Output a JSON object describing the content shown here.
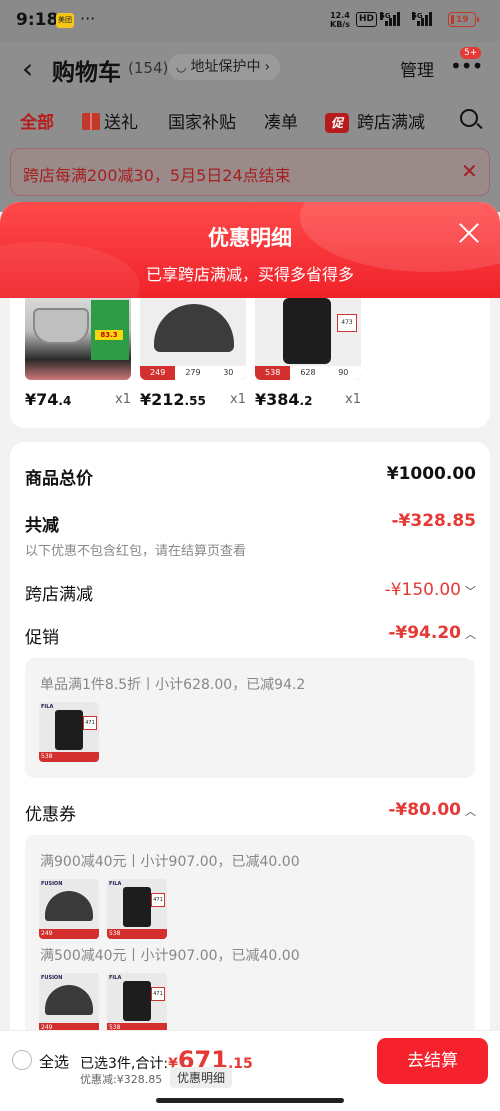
{
  "status_bar": {
    "time": "9:18",
    "app_badge": "美团",
    "net_speed": "12.4",
    "net_unit": "KB/s",
    "hd": "HD",
    "sig1": "5G",
    "sig2": "5G",
    "battery": "19",
    "battery_color": "#c0392b"
  },
  "header": {
    "title": "购物车",
    "count": "(154)",
    "address_label": "地址保护中",
    "manage": "管理",
    "badge": "5+"
  },
  "tabs": [
    {
      "label": "全部",
      "active": true
    },
    {
      "label": "送礼",
      "icon": "gift-icon"
    },
    {
      "label": "国家补贴"
    },
    {
      "label": "凑单"
    },
    {
      "label": "跨店满减",
      "icon": "promo-icon",
      "icon_text": "促"
    }
  ],
  "banner": {
    "text": "跨店每满200减30，5月5日24点结束"
  },
  "sheet": {
    "title": "优惠明细",
    "subtitle": "已享跨店满减，买得多省得多",
    "accent": "#f5222d"
  },
  "products": [
    {
      "price_int": "¥74",
      "price_dec": ".4",
      "qty": "x1",
      "kind": "pot-icon"
    },
    {
      "price_int": "¥212",
      "price_dec": ".55",
      "qty": "x1",
      "kind": "cap-icon",
      "bar": [
        "249",
        "279",
        "30"
      ]
    },
    {
      "price_int": "¥384",
      "price_dec": ".2",
      "qty": "x1",
      "kind": "backpack-icon",
      "tag": "473",
      "bar": [
        "538",
        "628",
        "90"
      ]
    }
  ],
  "pot_tag": "83.3",
  "summary": {
    "total_label": "商品总价",
    "total_value": "¥1000.00",
    "reduce_label": "共减",
    "reduce_value": "-¥328.85",
    "note": "以下优惠不包含红包，请在结算页查看",
    "cross_store_label": "跨店满减",
    "cross_store_value": "-¥150.00",
    "promo_label": "促销",
    "promo_value": "-¥94.20",
    "promo_detail": "单品满1件8.5折丨小计628.00，已减94.2",
    "coupon_label": "优惠券",
    "coupon_value": "-¥80.00",
    "coupon1_detail": "满900减40元丨小计907.00，已减40.00",
    "coupon2_detail": "满500减40元丨小计907.00，已减40.00"
  },
  "thumbs": {
    "brand_fila": "FILA",
    "tag_471": "471",
    "bar_538": "538",
    "bar_249": "249",
    "brand_cap": "FUSION"
  },
  "bottom": {
    "select_all": "全选",
    "selected_text": "已选3件,合计:",
    "total_currency": "¥",
    "total_int": "671",
    "total_dec": ".15",
    "saved_text": "优惠减:¥328.85",
    "detail_btn": "优惠明细",
    "checkout": "去结算"
  }
}
